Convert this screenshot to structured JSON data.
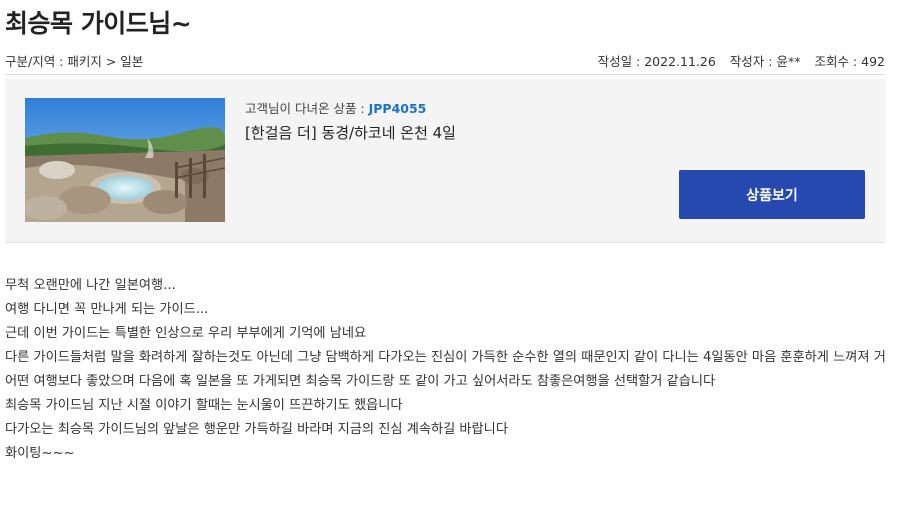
{
  "page": {
    "title": "최승목 가이드님~"
  },
  "meta": {
    "category": "구분/지역 : 패키지 > 일본",
    "date": "작성일 : 2022.11.26",
    "author": "작성자 : 윤**",
    "views": "조회수 : 492"
  },
  "product": {
    "code_label": "고객님이 다녀온 상품 : ",
    "code": "JPP4055",
    "name": "[한걸음 더] 동경/하코네 온천 4일",
    "button_label": "상품보기"
  },
  "content": {
    "lines": [
      "무척 오랜만에 나간 일본여행...",
      "여행 다니면 꼭 만나게 되는 가이드...",
      "근데 이번 가이드는 특별한 인상으로 우리 부부에게 기억에 남네요",
      "다른 가이드들처럼 말을 화려하게 잘하는것도 아닌데 그냥 담백하게 다가오는 진심이 가득한 순수한 열의 때문인지 같이 다니는 4일동안 마음 훈훈하게 느껴져 거 어떤 여행보다 좋았으며 다음에 혹 일본을 또 가게되면 최승목 가이드랑 또 같이 가고 싶어서라도 참좋은여행을 선택할거 같습니다",
      "최승목 가이드님 지난 시절 이야기 할때는 눈시울이 뜨끈하기도 했읍니다",
      "다가오는 최승목 가이드님의 앞날은 행운만 가득하길 바라며 지금의 진심 계속하길 바랍니다",
      "화이팅~~~"
    ]
  },
  "colors": {
    "accent": "#2649b0",
    "code": "#1a73c6",
    "box_bg": "#f4f4f4"
  }
}
